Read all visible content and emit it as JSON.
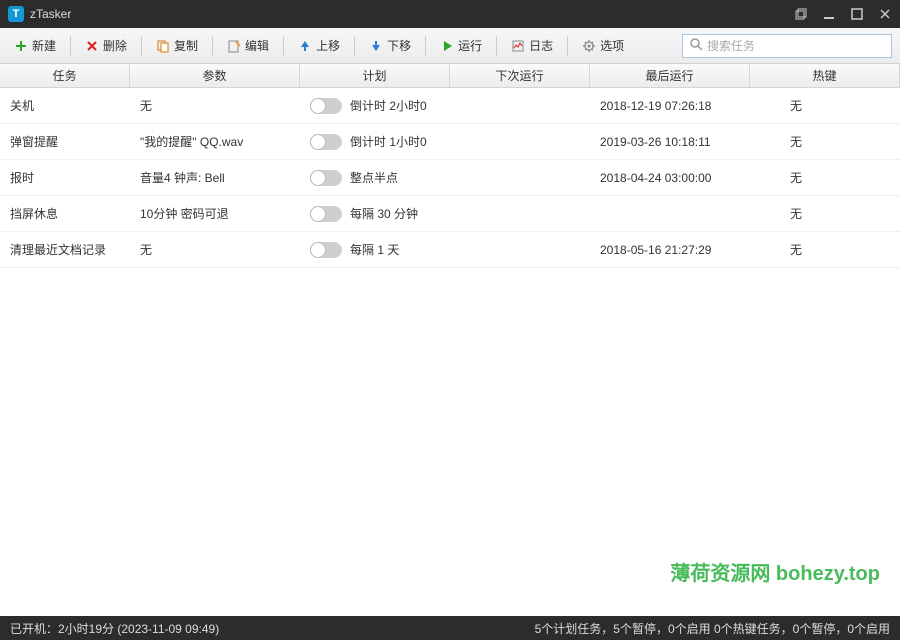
{
  "titlebar": {
    "app_letter": "T",
    "title": "zTasker"
  },
  "toolbar": {
    "new": "新建",
    "delete": "删除",
    "copy": "复制",
    "edit": "编辑",
    "moveup": "上移",
    "movedown": "下移",
    "run": "运行",
    "log": "日志",
    "options": "选项"
  },
  "search": {
    "placeholder": "搜索任务"
  },
  "columns": {
    "task": "任务",
    "param": "参数",
    "plan": "计划",
    "next": "下次运行",
    "last": "最后运行",
    "hotkey": "热键"
  },
  "rows": [
    {
      "task": "关机",
      "param": "无",
      "plan": "倒计时 2小时0",
      "next": "",
      "last": "2018-12-19 07:26:18",
      "hotkey": "无"
    },
    {
      "task": "弹窗提醒",
      "param": "\"我的提醒\" QQ.wav",
      "plan": "倒计时 1小时0",
      "next": "",
      "last": "2019-03-26 10:18:11",
      "hotkey": "无"
    },
    {
      "task": "报时",
      "param": "音量4 钟声: Bell",
      "plan": "整点半点",
      "next": "",
      "last": "2018-04-24 03:00:00",
      "hotkey": "无"
    },
    {
      "task": "挡屏休息",
      "param": "10分钟 密码可退",
      "plan": "每隔 30 分钟",
      "next": "",
      "last": "",
      "hotkey": "无"
    },
    {
      "task": "清理最近文档记录",
      "param": "无",
      "plan": "每隔 1 天",
      "next": "",
      "last": "2018-05-16 21:27:29",
      "hotkey": "无"
    }
  ],
  "watermark": "薄荷资源网  bohezy.top",
  "statusbar": {
    "left": "已开机：2小时19分 (2023-11-09 09:49)",
    "right": "5个计划任务，5个暂停，0个启用    0个热键任务，0个暂停，0个启用"
  }
}
